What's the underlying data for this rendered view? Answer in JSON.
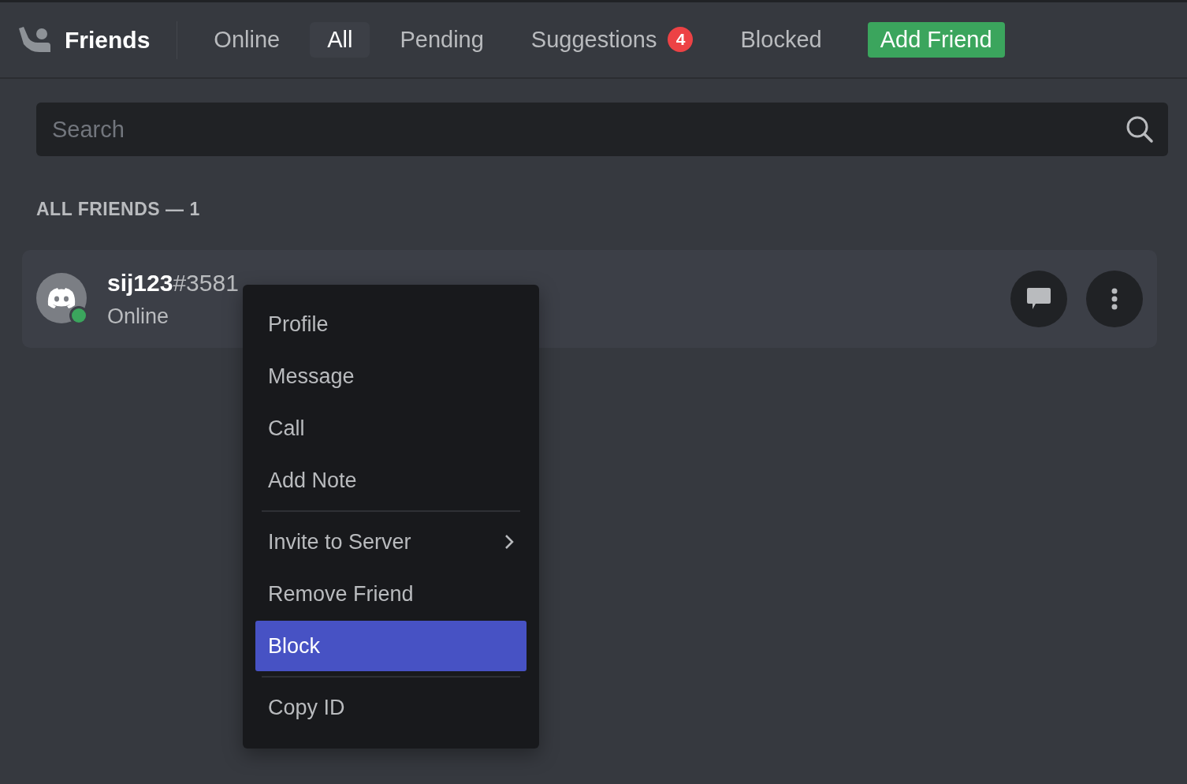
{
  "header": {
    "title": "Friends",
    "tabs": [
      {
        "label": "Online",
        "kind": "tab",
        "selected": false
      },
      {
        "label": "All",
        "kind": "tab",
        "selected": true
      },
      {
        "label": "Pending",
        "kind": "tab",
        "selected": false
      },
      {
        "label": "Suggestions",
        "kind": "tab",
        "selected": false,
        "badge": "4"
      },
      {
        "label": "Blocked",
        "kind": "tab",
        "selected": false
      },
      {
        "label": "Add Friend",
        "kind": "button"
      }
    ]
  },
  "search": {
    "placeholder": "Search"
  },
  "section_label": "ALL FRIENDS — 1",
  "friends": [
    {
      "name": "**sij123**#3581",
      "status": "Online",
      "online": true
    }
  ],
  "context_menu": {
    "items": [
      {
        "kind": "item",
        "label": "Profile",
        "selected": false
      },
      {
        "kind": "item",
        "label": "Message",
        "selected": false
      },
      {
        "kind": "item",
        "label": "Call",
        "selected": false
      },
      {
        "kind": "item",
        "label": "Add Note",
        "selected": false
      },
      {
        "kind": "separator"
      },
      {
        "kind": "submenu",
        "label": "Invite to Server",
        "selected": false
      },
      {
        "kind": "item",
        "label": "Remove Friend",
        "selected": false
      },
      {
        "kind": "item",
        "label": "Block",
        "selected": true
      },
      {
        "kind": "separator"
      },
      {
        "kind": "item",
        "label": "Copy ID",
        "selected": false
      }
    ]
  }
}
